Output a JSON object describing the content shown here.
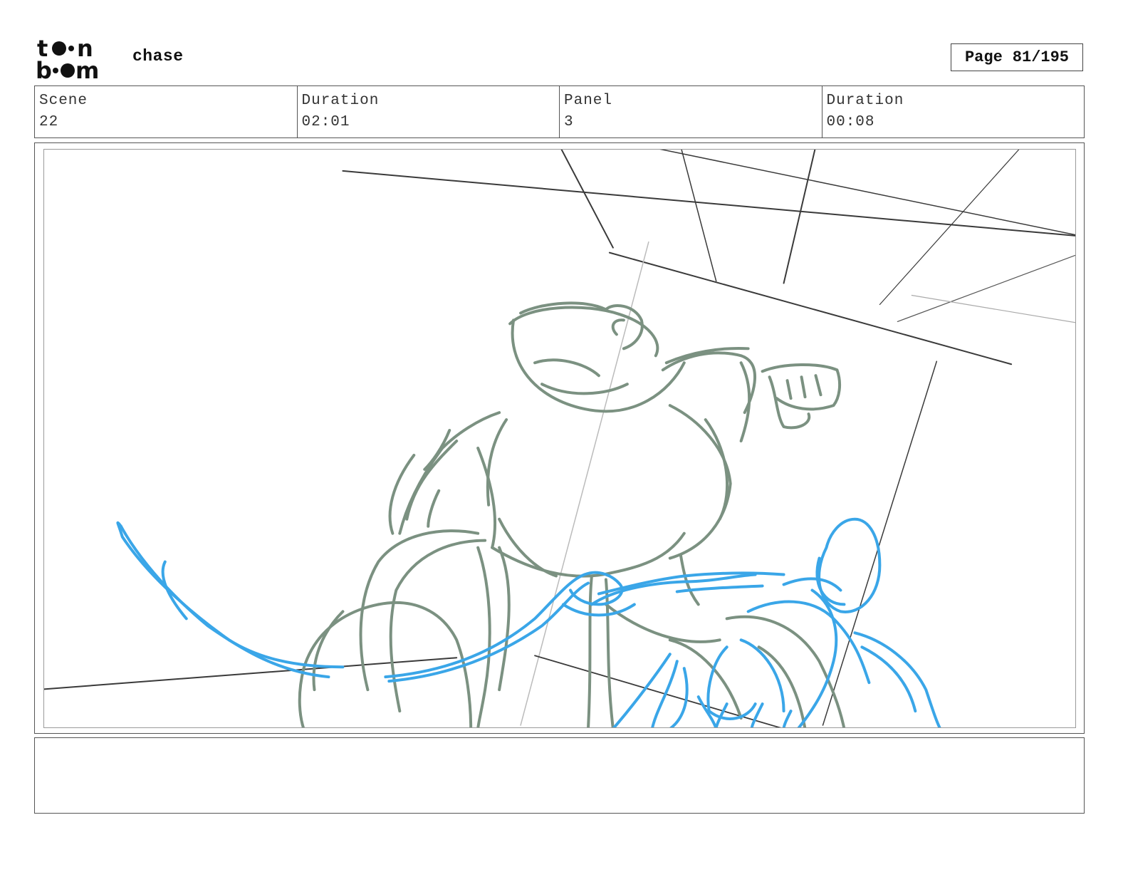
{
  "header": {
    "logo_text": "toon boom",
    "project_title": "chase",
    "page_label": "Page",
    "page_number": "81/195"
  },
  "info": {
    "scene_label": "Scene",
    "scene_value": "22",
    "scene_duration_label": "Duration",
    "scene_duration_value": "02:01",
    "panel_label": "Panel",
    "panel_value": "3",
    "panel_duration_label": "Duration",
    "panel_duration_value": "00:08"
  },
  "panel": {
    "sketch_colors": {
      "character_green": "#7b9181",
      "character_blue": "#3aa6e8",
      "perspective_dark": "#3a3a3a",
      "perspective_light": "#b8b8b8"
    }
  },
  "notes": {
    "dialogue": "",
    "action": ""
  }
}
